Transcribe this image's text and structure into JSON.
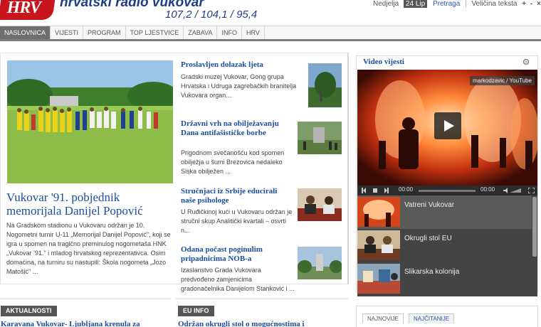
{
  "header": {
    "logo_text": "HRV",
    "station_name": "hrvatski radio vukovar",
    "frequencies": "107,2 / 104,1 / 95,4"
  },
  "top_tools": {
    "day": "Nedjelja",
    "date": "24 Lip",
    "search": "Pretraga",
    "separator": "|",
    "font_size_label": "Veličina teksta",
    "increase": "+",
    "decrease": "-",
    "reset": "×"
  },
  "nav": {
    "items": [
      "NASLOVNICA",
      "VIJESTI",
      "PROGRAM",
      "TOP LJESTVICE",
      "ZABAVA",
      "INFO",
      "HRV"
    ],
    "active_index": 0
  },
  "featured": {
    "title": "Vukovar '91. pobjednik memorijala Danijel Popović",
    "text": "Na Gradskom stadionu u Vukovaru održan je 10. Nogometni turnir U-11 „Memorijal Danijel Popović\", koji se igra u spomen na tragično preminulog nogometaša HNK „Vukovar '91.\" i mladog hrvatskog reprezentativca. Osim domaćina, na turniru su nastupili: Škola nogometa „Jozo Matošić\" ..."
  },
  "news": [
    {
      "title": "Proslavljen dolazak ljeta",
      "text": "Gradski muzej Vukovar, Gong grupa Hrvatska i Udruga zagrebačkih branitelja Vukovara organ..."
    },
    {
      "title": "Državni vrh na obilježavanju Dana antifašističke borbe",
      "text": "Prigodnom svečanošću kod spomen obilježja u šumi Brezovica nedaleko Siska obilježen ..."
    },
    {
      "title": "Stručnjaci iz Srbije educirali naše psihologe",
      "text": "U Ruđičkinoj kući u Vukovaru održan je stručni skup Analitički kvartali – osvrti n..."
    },
    {
      "title": "Odana počast poginulim pripadnicima NOB-a",
      "text": "Izaslanstvo Grada Vukovara predvođeno zamjenicima gradonačelnika Danijelom Stanković i ..."
    }
  ],
  "sections": {
    "left_label": "AKTUALNOSTI",
    "left_link": "Karavana Vukovar- Ljubljana krenula za",
    "right_label": "EU INFO",
    "right_link": "Održan okrugli stol o mogućnostima i"
  },
  "video": {
    "heading": "Video vijesti",
    "credit": "markodzavic / YouTube",
    "time_current": "00:00",
    "time_total": "00:00",
    "playlist": [
      "Vatreni Vukovar",
      "Okrugli stol EU",
      "Slikarska kolonija"
    ]
  },
  "tabs": {
    "items": [
      "NAJNOVIJE",
      "NAJČITANIJE"
    ],
    "active_index": 0
  },
  "colors": {
    "brand_red": "#c8141c",
    "link_blue": "#1b4ea3",
    "nav_active": "#6f6f6f"
  },
  "icons": [
    "gear-icon",
    "play-icon",
    "rewind-icon",
    "stop-icon",
    "forward-icon",
    "volume-icon",
    "fullscreen-icon"
  ]
}
